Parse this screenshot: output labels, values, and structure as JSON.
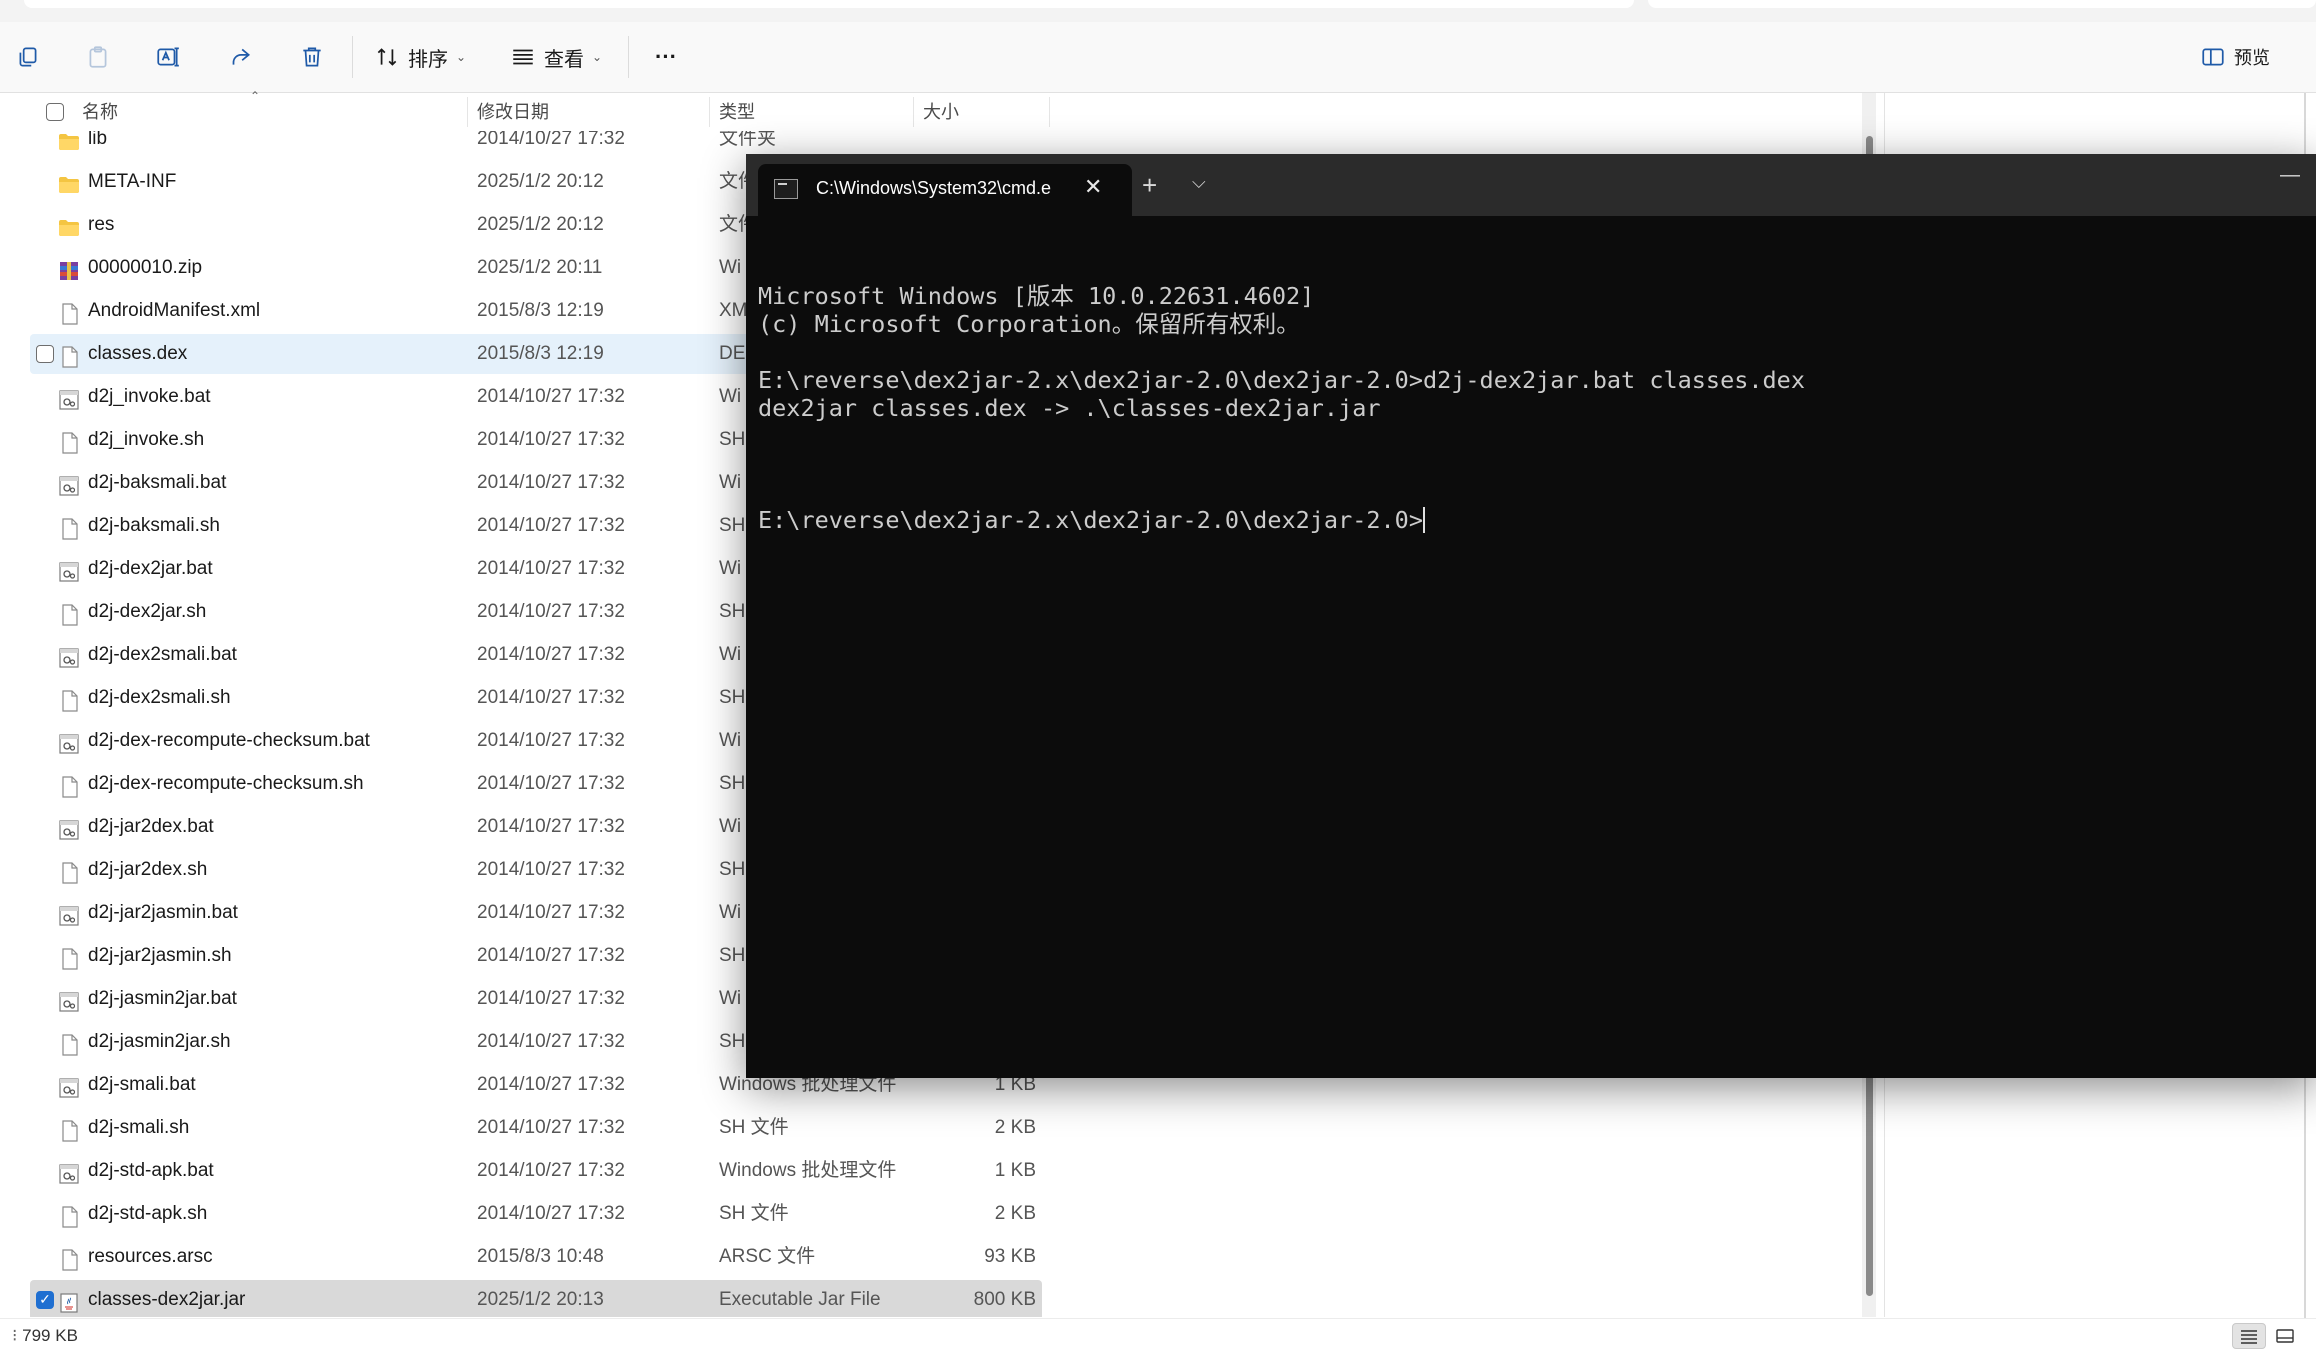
{
  "toolbar": {
    "sort_label": "排序",
    "view_label": "查看",
    "more_label": "···",
    "preview_label": "预览"
  },
  "columns": {
    "name": "名称",
    "date": "修改日期",
    "type": "类型",
    "size": "大小"
  },
  "files": [
    {
      "name": "lib",
      "date": "2014/10/27 17:32",
      "type": "文件夹",
      "size": "",
      "icon": "folder-icon"
    },
    {
      "name": "META-INF",
      "date": "2025/1/2 20:12",
      "type": "文件",
      "size": "",
      "icon": "folder-icon"
    },
    {
      "name": "res",
      "date": "2025/1/2 20:12",
      "type": "文件",
      "size": "",
      "icon": "folder-icon"
    },
    {
      "name": "00000010.zip",
      "date": "2025/1/2 20:11",
      "type": "Wi",
      "size": "",
      "icon": "zip-archive-icon"
    },
    {
      "name": "AndroidManifest.xml",
      "date": "2015/8/3 12:19",
      "type": "XM",
      "size": "",
      "icon": "file-icon"
    },
    {
      "name": "classes.dex",
      "date": "2015/8/3 12:19",
      "type": "DE",
      "size": "",
      "icon": "file-icon",
      "state": "hover"
    },
    {
      "name": "d2j_invoke.bat",
      "date": "2014/10/27 17:32",
      "type": "Wi",
      "size": "",
      "icon": "batch-file-icon"
    },
    {
      "name": "d2j_invoke.sh",
      "date": "2014/10/27 17:32",
      "type": "SH",
      "size": "",
      "icon": "file-icon"
    },
    {
      "name": "d2j-baksmali.bat",
      "date": "2014/10/27 17:32",
      "type": "Wi",
      "size": "",
      "icon": "batch-file-icon"
    },
    {
      "name": "d2j-baksmali.sh",
      "date": "2014/10/27 17:32",
      "type": "SH",
      "size": "",
      "icon": "file-icon"
    },
    {
      "name": "d2j-dex2jar.bat",
      "date": "2014/10/27 17:32",
      "type": "Wi",
      "size": "",
      "icon": "batch-file-icon"
    },
    {
      "name": "d2j-dex2jar.sh",
      "date": "2014/10/27 17:32",
      "type": "SH",
      "size": "",
      "icon": "file-icon"
    },
    {
      "name": "d2j-dex2smali.bat",
      "date": "2014/10/27 17:32",
      "type": "Wi",
      "size": "",
      "icon": "batch-file-icon"
    },
    {
      "name": "d2j-dex2smali.sh",
      "date": "2014/10/27 17:32",
      "type": "SH",
      "size": "",
      "icon": "file-icon"
    },
    {
      "name": "d2j-dex-recompute-checksum.bat",
      "date": "2014/10/27 17:32",
      "type": "Wi",
      "size": "",
      "icon": "batch-file-icon"
    },
    {
      "name": "d2j-dex-recompute-checksum.sh",
      "date": "2014/10/27 17:32",
      "type": "SH",
      "size": "",
      "icon": "file-icon"
    },
    {
      "name": "d2j-jar2dex.bat",
      "date": "2014/10/27 17:32",
      "type": "Wi",
      "size": "",
      "icon": "batch-file-icon"
    },
    {
      "name": "d2j-jar2dex.sh",
      "date": "2014/10/27 17:32",
      "type": "SH",
      "size": "",
      "icon": "file-icon"
    },
    {
      "name": "d2j-jar2jasmin.bat",
      "date": "2014/10/27 17:32",
      "type": "Wi",
      "size": "",
      "icon": "batch-file-icon"
    },
    {
      "name": "d2j-jar2jasmin.sh",
      "date": "2014/10/27 17:32",
      "type": "SH",
      "size": "",
      "icon": "file-icon"
    },
    {
      "name": "d2j-jasmin2jar.bat",
      "date": "2014/10/27 17:32",
      "type": "Wi",
      "size": "",
      "icon": "batch-file-icon"
    },
    {
      "name": "d2j-jasmin2jar.sh",
      "date": "2014/10/27 17:32",
      "type": "SH",
      "size": "",
      "icon": "file-icon"
    },
    {
      "name": "d2j-smali.bat",
      "date": "2014/10/27 17:32",
      "type": "Windows 批处理文件",
      "size": "1 KB",
      "icon": "batch-file-icon"
    },
    {
      "name": "d2j-smali.sh",
      "date": "2014/10/27 17:32",
      "type": "SH 文件",
      "size": "2 KB",
      "icon": "file-icon"
    },
    {
      "name": "d2j-std-apk.bat",
      "date": "2014/10/27 17:32",
      "type": "Windows 批处理文件",
      "size": "1 KB",
      "icon": "batch-file-icon"
    },
    {
      "name": "d2j-std-apk.sh",
      "date": "2014/10/27 17:32",
      "type": "SH 文件",
      "size": "2 KB",
      "icon": "file-icon"
    },
    {
      "name": "resources.arsc",
      "date": "2015/8/3 10:48",
      "type": "ARSC 文件",
      "size": "93 KB",
      "icon": "file-icon"
    },
    {
      "name": "classes-dex2jar.jar",
      "date": "2025/1/2 20:13",
      "type": "Executable Jar File",
      "size": "800 KB",
      "icon": "jar-file-icon",
      "state": "selected"
    }
  ],
  "status": {
    "selection_size": "799 KB"
  },
  "terminal": {
    "tab_title": "C:\\Windows\\System32\\cmd.e",
    "lines": [
      "Microsoft Windows [版本 10.0.22631.4602]",
      "(c) Microsoft Corporation。保留所有权利。",
      "",
      "E:\\reverse\\dex2jar-2.x\\dex2jar-2.0\\dex2jar-2.0>d2j-dex2jar.bat classes.dex",
      "dex2jar classes.dex -> .\\classes-dex2jar.jar",
      ""
    ],
    "prompt": "E:\\reverse\\dex2jar-2.x\\dex2jar-2.0\\dex2jar-2.0>"
  },
  "colors": {
    "accent": "#1f6fd1",
    "terminal_bg": "#0c0c0c",
    "terminal_text": "#cccccc",
    "hover_row": "#e5f1fb",
    "selected_row": "#d9d9d9"
  }
}
